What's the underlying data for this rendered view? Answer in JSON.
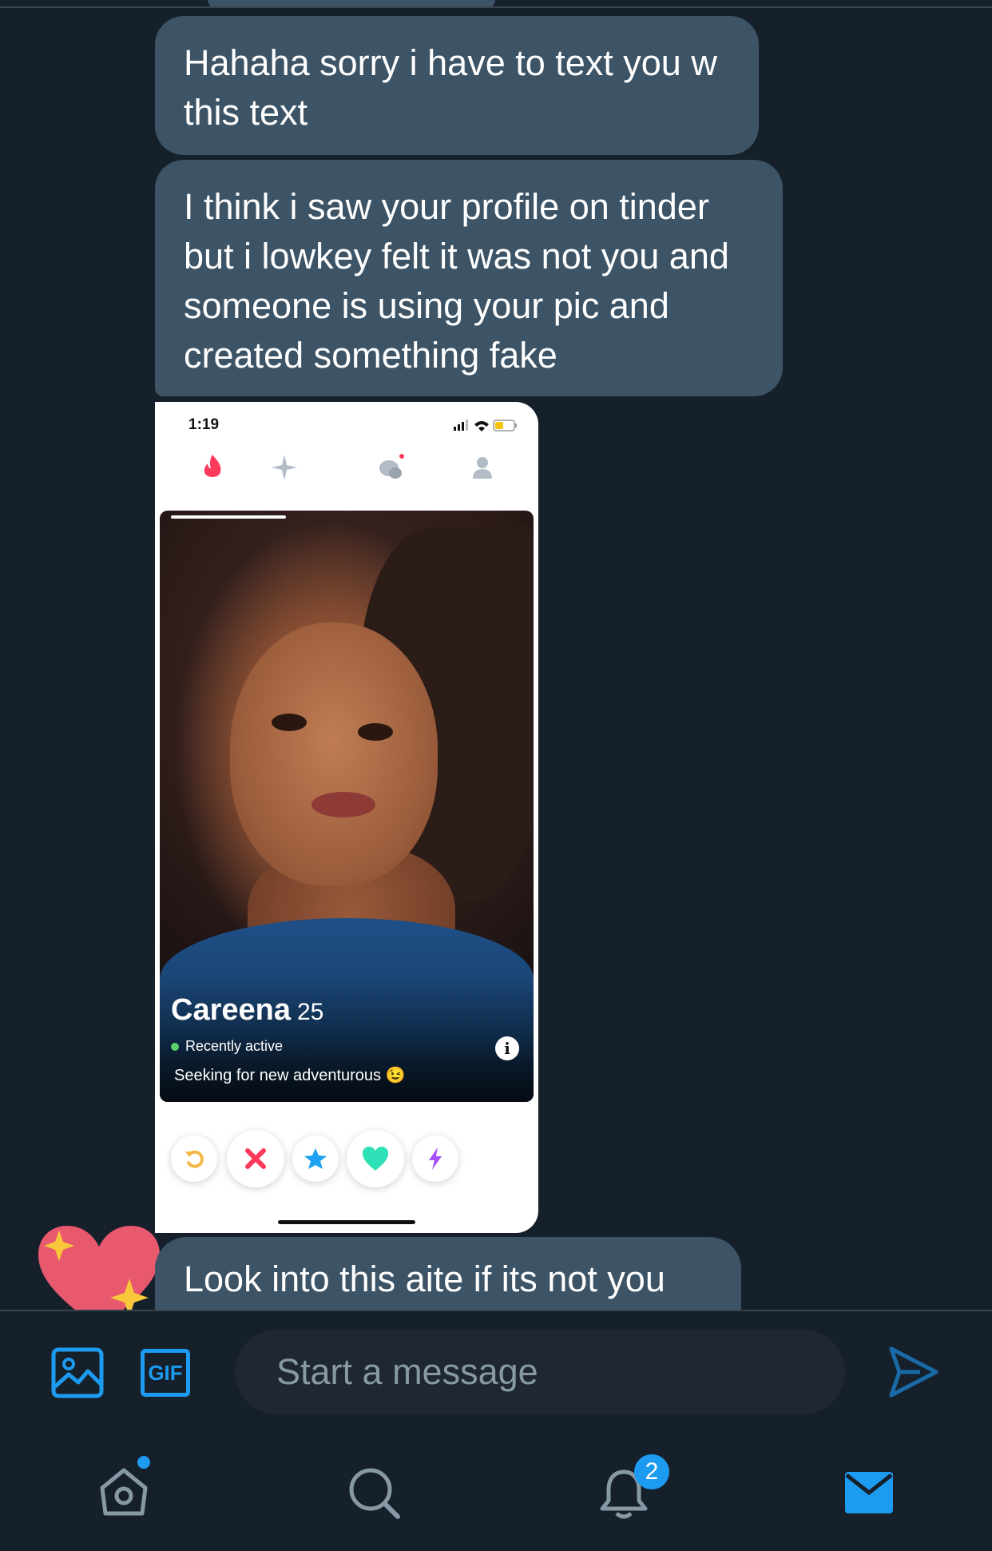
{
  "messages": [
    {
      "text": "Hahaha sorry i have to text you w this text"
    },
    {
      "text": "I think i saw your profile on tinder but i lowkey felt it was not you and someone is using your pic and created something fake"
    },
    {
      "text": "Look into this aite if its not you"
    }
  ],
  "attachment": {
    "status_time": "1:19",
    "profile": {
      "name": "Careena",
      "age": "25",
      "activity": "Recently active",
      "bio": "Seeking for new adventurous 😉",
      "info_label": "i"
    },
    "nav_icons": [
      "flame-icon",
      "sparkle-icon",
      "chat-icon",
      "profile-icon"
    ],
    "action_icons": [
      "rewind-icon",
      "nope-icon",
      "super-like-icon",
      "like-icon",
      "boost-icon"
    ]
  },
  "composer": {
    "placeholder": "Start a message",
    "gif_label": "GIF",
    "icons": [
      "image-icon",
      "gif-icon",
      "send-icon"
    ]
  },
  "bottom_nav": {
    "notifications_badge": "2",
    "icons": [
      "home-icon",
      "search-icon",
      "notifications-icon",
      "messages-icon"
    ]
  },
  "colors": {
    "background": "#15202b",
    "bubble": "#3d5466",
    "accent": "#1d9bf0",
    "placeholder": "#8899a6"
  }
}
